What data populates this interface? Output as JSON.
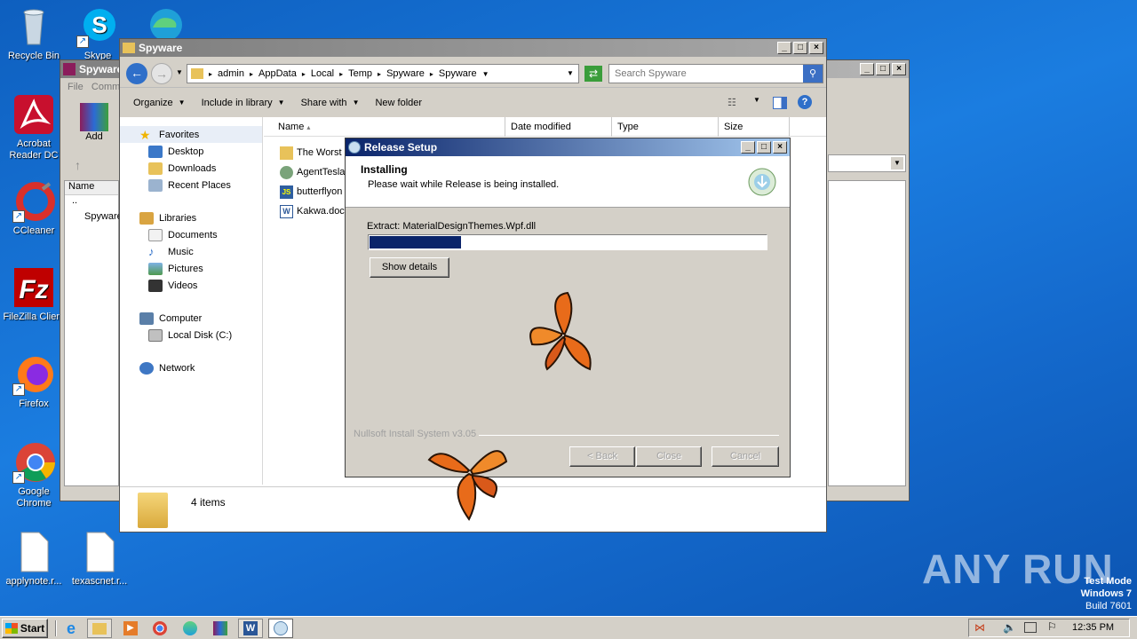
{
  "desktop_icons": [
    {
      "label": "Recycle Bin"
    },
    {
      "label": "Skype"
    },
    {
      "label": "Acrobat Reader DC"
    },
    {
      "label": "CCleaner"
    },
    {
      "label": "FileZilla Client"
    },
    {
      "label": "Firefox"
    },
    {
      "label": "Google Chrome"
    },
    {
      "label": "applynote.r..."
    },
    {
      "label": "texascnet.r..."
    }
  ],
  "back_window": {
    "title": "Spyware",
    "menu": [
      "File",
      "Comm"
    ],
    "add_label": "Add",
    "column_name": "Name",
    "rows": [
      "..",
      "Spyware"
    ]
  },
  "explorer": {
    "title": "Spyware",
    "breadcrumb": [
      "admin",
      "AppData",
      "Local",
      "Temp",
      "Spyware",
      "Spyware"
    ],
    "search_placeholder": "Search Spyware",
    "toolbar": {
      "organize": "Organize",
      "include_in_library": "Include in library",
      "share_with": "Share with",
      "new_folder": "New folder"
    },
    "nav": {
      "favorites": "Favorites",
      "desktop": "Desktop",
      "downloads": "Downloads",
      "recent_places": "Recent Places",
      "libraries": "Libraries",
      "documents": "Documents",
      "music": "Music",
      "pictures": "Pictures",
      "videos": "Videos",
      "computer": "Computer",
      "local_disk": "Local Disk (C:)",
      "network": "Network"
    },
    "columns": {
      "name": "Name",
      "date_modified": "Date modified",
      "type": "Type",
      "size": "Size"
    },
    "files": [
      {
        "name": "The Worst (",
        "icon": "folder-icon"
      },
      {
        "name": "AgentTesla",
        "icon": "app-icon"
      },
      {
        "name": "butterflyon",
        "icon": "script-icon"
      },
      {
        "name": "Kakwa.doc",
        "icon": "word-doc-icon"
      }
    ],
    "status_items": "4 items"
  },
  "setup": {
    "title": "Release Setup",
    "heading": "Installing",
    "subheading": "Please wait while Release is being installed.",
    "status": "Extract: MaterialDesignThemes.Wpf.dll",
    "progress": 0.23,
    "show_details": "Show details",
    "branding": "Nullsoft Install System v3.05",
    "back": "< Back",
    "close": "Close",
    "cancel": "Cancel"
  },
  "watermark": {
    "brand": "ANY RUN",
    "line1": "Test Mode",
    "line2": "Windows 7",
    "line3": "Build 7601"
  },
  "taskbar": {
    "start": "Start",
    "clock": "12:35 PM"
  },
  "colors": {
    "title_active": "#0a246a",
    "title_inactive": "#808080",
    "progress_fill": "#0a246a",
    "desktop": "#1673d6"
  }
}
